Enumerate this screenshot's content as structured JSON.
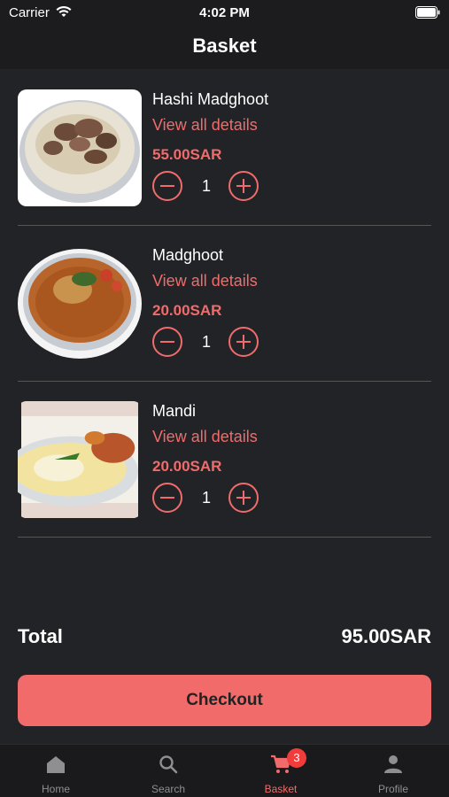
{
  "status": {
    "carrier": "Carrier",
    "time": "4:02 PM"
  },
  "header": {
    "title": "Basket"
  },
  "items": [
    {
      "name": "Hashi Madghoot",
      "details": "View all details",
      "price": "55.00SAR",
      "qty": "1"
    },
    {
      "name": "Madghoot",
      "details": "View all details",
      "price": "20.00SAR",
      "qty": "1"
    },
    {
      "name": "Mandi",
      "details": "View all details",
      "price": "20.00SAR",
      "qty": "1"
    }
  ],
  "summary": {
    "total_label": "Total",
    "total_value": "95.00SAR"
  },
  "checkout": {
    "label": "Checkout"
  },
  "tabs": [
    {
      "label": "Home",
      "icon": "home-icon"
    },
    {
      "label": "Search",
      "icon": "search-icon"
    },
    {
      "label": "Basket",
      "icon": "cart-icon",
      "badge": "3"
    },
    {
      "label": "Profile",
      "icon": "person-icon"
    }
  ],
  "colors": {
    "accent": "#f06c6c",
    "background": "#222326",
    "button": "#f26b6b",
    "badge": "#f23b3b"
  }
}
